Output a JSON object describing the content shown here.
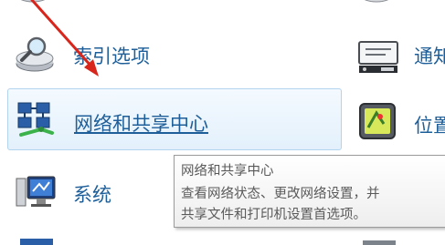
{
  "items": {
    "indexing": {
      "label": "索引选项",
      "icon": "magnifier-drive-icon"
    },
    "network": {
      "label": "网络和共享中心",
      "icon": "network-computers-icon"
    },
    "system": {
      "label": "系统",
      "icon": "computer-monitor-icon"
    },
    "notification": {
      "label": "通知",
      "icon": "notification-tray-icon"
    },
    "location": {
      "label": "位置",
      "icon": "location-gps-icon"
    }
  },
  "tooltip": {
    "title": "网络和共享中心",
    "line1": "查看网络状态、更改网络设置，并",
    "line2": "共享文件和打印机设置首选项。"
  },
  "colors": {
    "link_green": "#1aa04a",
    "label_blue": "#1e5f9a",
    "arrow_red": "#d9261c"
  }
}
